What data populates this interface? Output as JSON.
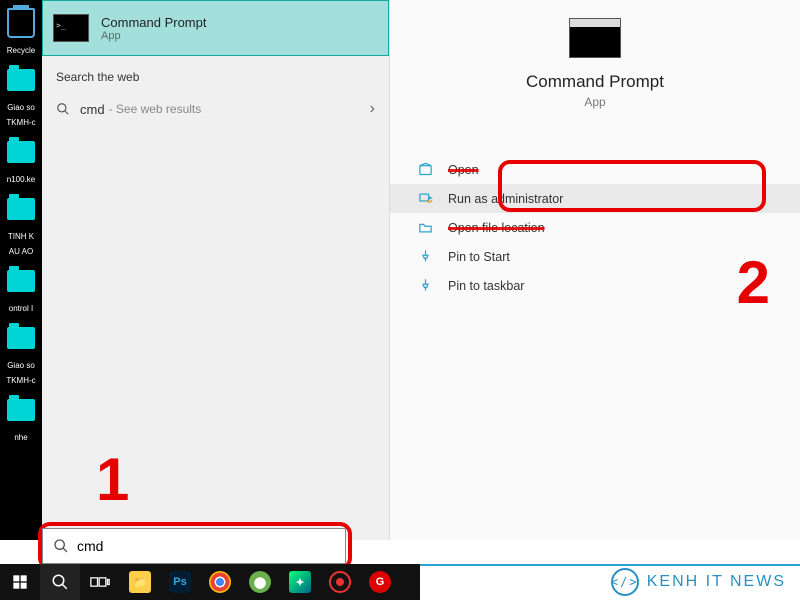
{
  "desktop": {
    "labels": [
      "",
      "Recycle",
      "",
      "Giao so",
      "TKMH-c",
      "",
      "n100.ke",
      "",
      "TINH K",
      "AU AO",
      "",
      "ontrol I",
      "",
      "Giao so",
      "TKMH-c",
      "",
      "nhe"
    ]
  },
  "bestMatch": {
    "title": "Command Prompt",
    "subtitle": "App"
  },
  "web": {
    "heading": "Search the web",
    "query": "cmd",
    "hint": "- See web results"
  },
  "details": {
    "title": "Command Prompt",
    "subtitle": "App",
    "actions": [
      {
        "label": "Open",
        "icon": "open",
        "struck": true
      },
      {
        "label": "Run as administrator",
        "icon": "admin",
        "hover": true
      },
      {
        "label": "Open file location",
        "icon": "folder",
        "struck": true
      },
      {
        "label": "Pin to Start",
        "icon": "pin"
      },
      {
        "label": "Pin to taskbar",
        "icon": "pin"
      }
    ]
  },
  "annotations": {
    "step1": "1",
    "step2": "2"
  },
  "searchBox": {
    "value": "cmd"
  },
  "watermark": {
    "text": "KENH IT NEWS",
    "logo": "</>"
  }
}
